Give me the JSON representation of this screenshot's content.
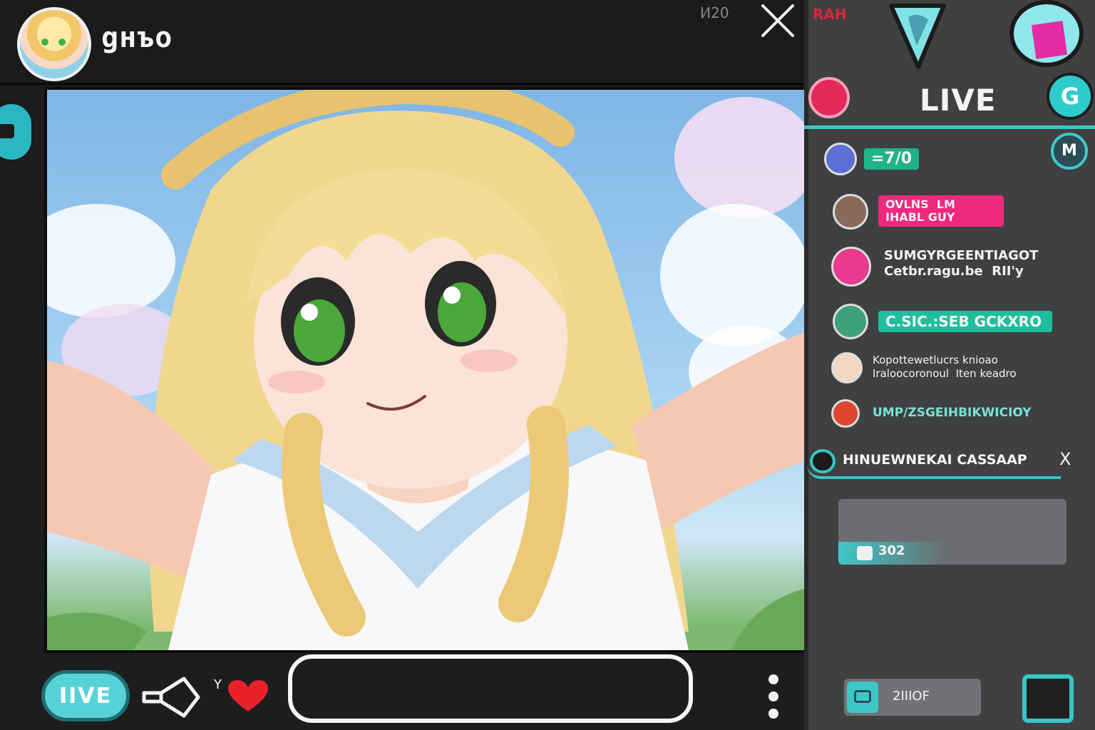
{
  "header": {
    "streamer_name": "gнъо",
    "meta": "I⁄I20",
    "top_tag": "RAH"
  },
  "controls": {
    "live_label": "IIVE",
    "like_count": "Y",
    "comment_placeholder": ""
  },
  "chat": {
    "title": "LIVE",
    "settings_glyph": "G",
    "mod_glyph": "M",
    "messages": [
      {
        "text": "=7/0",
        "style": "pill",
        "color": "#1fb38a",
        "avatar_color": "#5b6fd6"
      },
      {
        "text": "OVLNS  LM\nIHABL GUY",
        "style": "pill",
        "color": "#f0287e",
        "avatar_color": "#8a6a5a"
      },
      {
        "text": "SUMGYRGEENTIAGOT\nCetbr.ragu.be  RII'y",
        "style": "plain",
        "color": "",
        "avatar_color": "#e93a8f"
      },
      {
        "text": "C.SIC.:SEB GCKXRO",
        "style": "pill",
        "color": "#1dbf9e",
        "avatar_color": "#3ca07a"
      },
      {
        "text": "Kopottewetlucrs knioao\nIraloocoronoul  Iten keadro",
        "style": "plain",
        "color": "",
        "avatar_color": "#f3d7c3"
      },
      {
        "text": "UMP/ZSGEIHBIKWICIOY",
        "style": "mixed",
        "color": "#1dbf9e",
        "avatar_color": "#e0452f"
      }
    ],
    "pinned": "HINUEWNEKAI  CASSAAP",
    "pinned_close": "X",
    "compose_label": "302",
    "bottom_action_label": "2IIIOF"
  },
  "colors": {
    "accent": "#36c7c4",
    "live_red": "#e42a59",
    "heart": "#e8212c"
  }
}
